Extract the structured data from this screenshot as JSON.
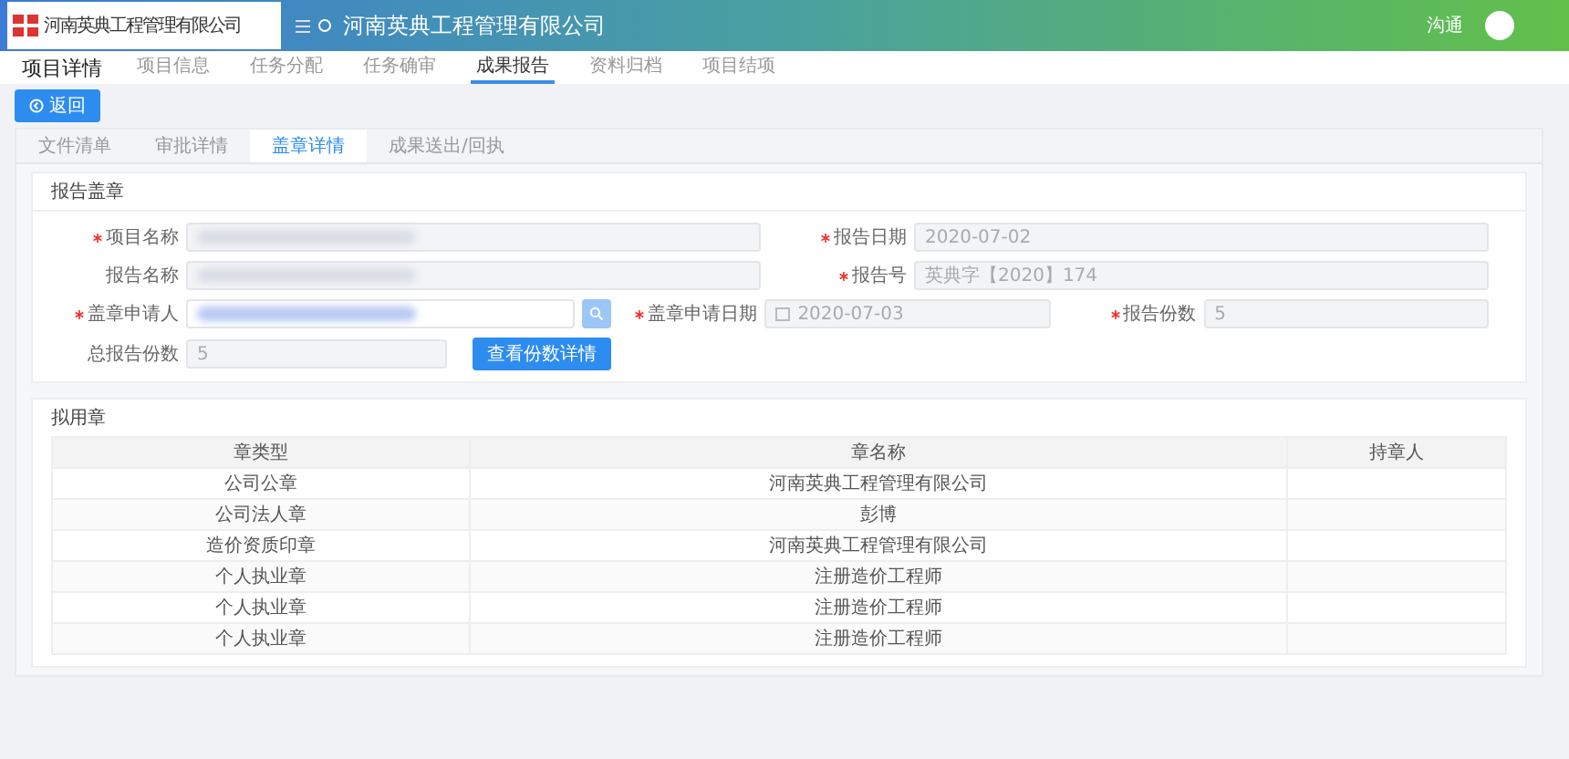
{
  "header": {
    "logo_text": "河南英典工程管理有限公司",
    "title": "河南英典工程管理有限公司",
    "user": "沟通"
  },
  "nav": {
    "heading": "项目详情",
    "items": [
      {
        "label": "项目信息",
        "selected": false
      },
      {
        "label": "任务分配",
        "selected": false
      },
      {
        "label": "任务确审",
        "selected": false
      },
      {
        "label": "成果报告",
        "selected": true
      },
      {
        "label": "资料归档",
        "selected": false
      },
      {
        "label": "项目结项",
        "selected": false
      }
    ]
  },
  "back_button": "返回",
  "tabs": [
    {
      "label": "文件清单",
      "selected": false
    },
    {
      "label": "审批详情",
      "selected": false
    },
    {
      "label": "盖章详情",
      "selected": true
    },
    {
      "label": "成果送出/回执",
      "selected": false
    }
  ],
  "form": {
    "title": "报告盖章",
    "fields": [
      {
        "kind": "redacted",
        "label": "项目名称",
        "required": true
      },
      {
        "kind": "text",
        "label": "报告日期",
        "required": true,
        "value": "2020-07-02"
      },
      {
        "kind": "redacted",
        "label": "报告名称",
        "required": false
      },
      {
        "kind": "text",
        "label": "报告号",
        "required": true,
        "value": "英典字【2020】174"
      },
      {
        "kind": "search",
        "label": "盖章申请人",
        "required": true
      },
      {
        "kind": "date",
        "label": "盖章申请日期",
        "required": true,
        "value": "2020-07-03"
      },
      {
        "kind": "text",
        "label": "报告份数",
        "required": true,
        "value": "5"
      },
      {
        "kind": "text",
        "label": "总报告份数",
        "required": false,
        "value": "5"
      }
    ],
    "detail_button": "查看份数详情"
  },
  "table": {
    "title": "拟用章",
    "columns": [
      "章类型",
      "章名称",
      "持章人"
    ],
    "rows": [
      [
        "公司公章",
        "河南英典工程管理有限公司"
      ],
      [
        "公司法人章",
        "彭博"
      ],
      [
        "造价资质印章",
        "河南英典工程管理有限公司"
      ],
      [
        "个人执业章",
        "注册造价工程师"
      ],
      [
        "个人执业章",
        "注册造价工程师"
      ],
      [
        "个人执业章",
        "注册造价工程师"
      ]
    ]
  }
}
